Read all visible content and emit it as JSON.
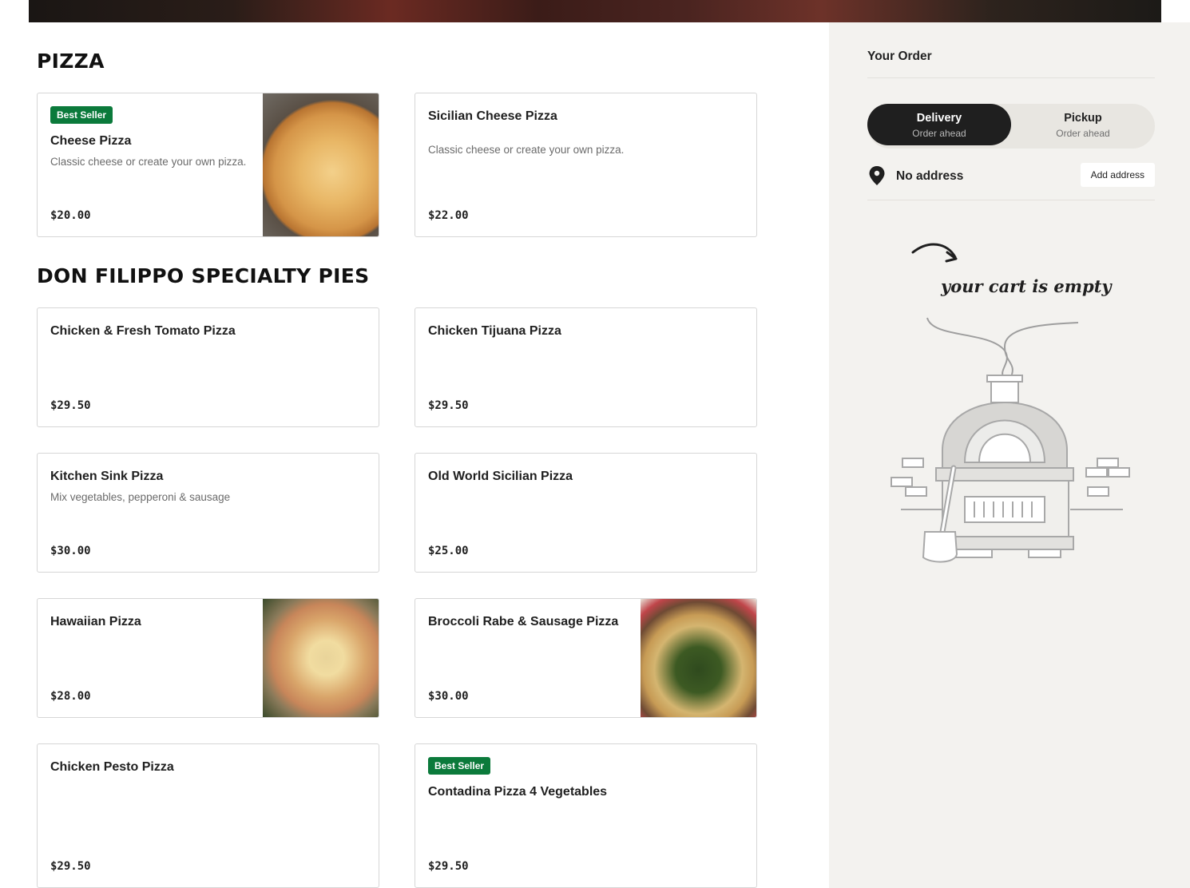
{
  "sections": [
    {
      "title": "PIZZA",
      "items": [
        {
          "badge": "Best Seller",
          "name": "Cheese Pizza",
          "desc": "Classic cheese or create your own pizza.",
          "price": "$20.00",
          "image": "cheese-pizza-photo"
        },
        {
          "badge": "",
          "name": "Sicilian Cheese Pizza",
          "desc": "Classic cheese or create your own pizza.",
          "price": "$22.00",
          "image": ""
        }
      ]
    },
    {
      "title": "DON FILIPPO SPECIALTY PIES",
      "items": [
        {
          "badge": "",
          "name": "Chicken & Fresh Tomato Pizza",
          "desc": "",
          "price": "$29.50",
          "image": ""
        },
        {
          "badge": "",
          "name": "Chicken Tijuana Pizza",
          "desc": "",
          "price": "$29.50",
          "image": ""
        },
        {
          "badge": "",
          "name": "Kitchen Sink Pizza",
          "desc": "Mix vegetables, pepperoni & sausage",
          "price": "$30.00",
          "image": ""
        },
        {
          "badge": "",
          "name": "Old World Sicilian Pizza",
          "desc": "",
          "price": "$25.00",
          "image": ""
        },
        {
          "badge": "",
          "name": "Hawaiian Pizza",
          "desc": "",
          "price": "$28.00",
          "image": "hawaiian-pizza-photo"
        },
        {
          "badge": "",
          "name": "Broccoli Rabe & Sausage Pizza",
          "desc": "",
          "price": "$30.00",
          "image": "broccoli-rabe-pizza-photo"
        },
        {
          "badge": "",
          "name": "Chicken Pesto Pizza",
          "desc": "",
          "price": "$29.50",
          "image": ""
        },
        {
          "badge": "Best Seller",
          "name": "Contadina Pizza 4 Vegetables",
          "desc": "",
          "price": "$29.50",
          "image": ""
        }
      ]
    }
  ],
  "sidebar": {
    "title": "Your Order",
    "delivery": {
      "label": "Delivery",
      "sub": "Order ahead"
    },
    "pickup": {
      "label": "Pickup",
      "sub": "Order ahead"
    },
    "address": {
      "text": "No address",
      "button": "Add address"
    },
    "empty_cart": "your cart is empty"
  },
  "colors": {
    "badge": "#0b7a3b",
    "sidebar_bg": "#f3f2ef",
    "active_toggle": "#1f1f1f"
  }
}
